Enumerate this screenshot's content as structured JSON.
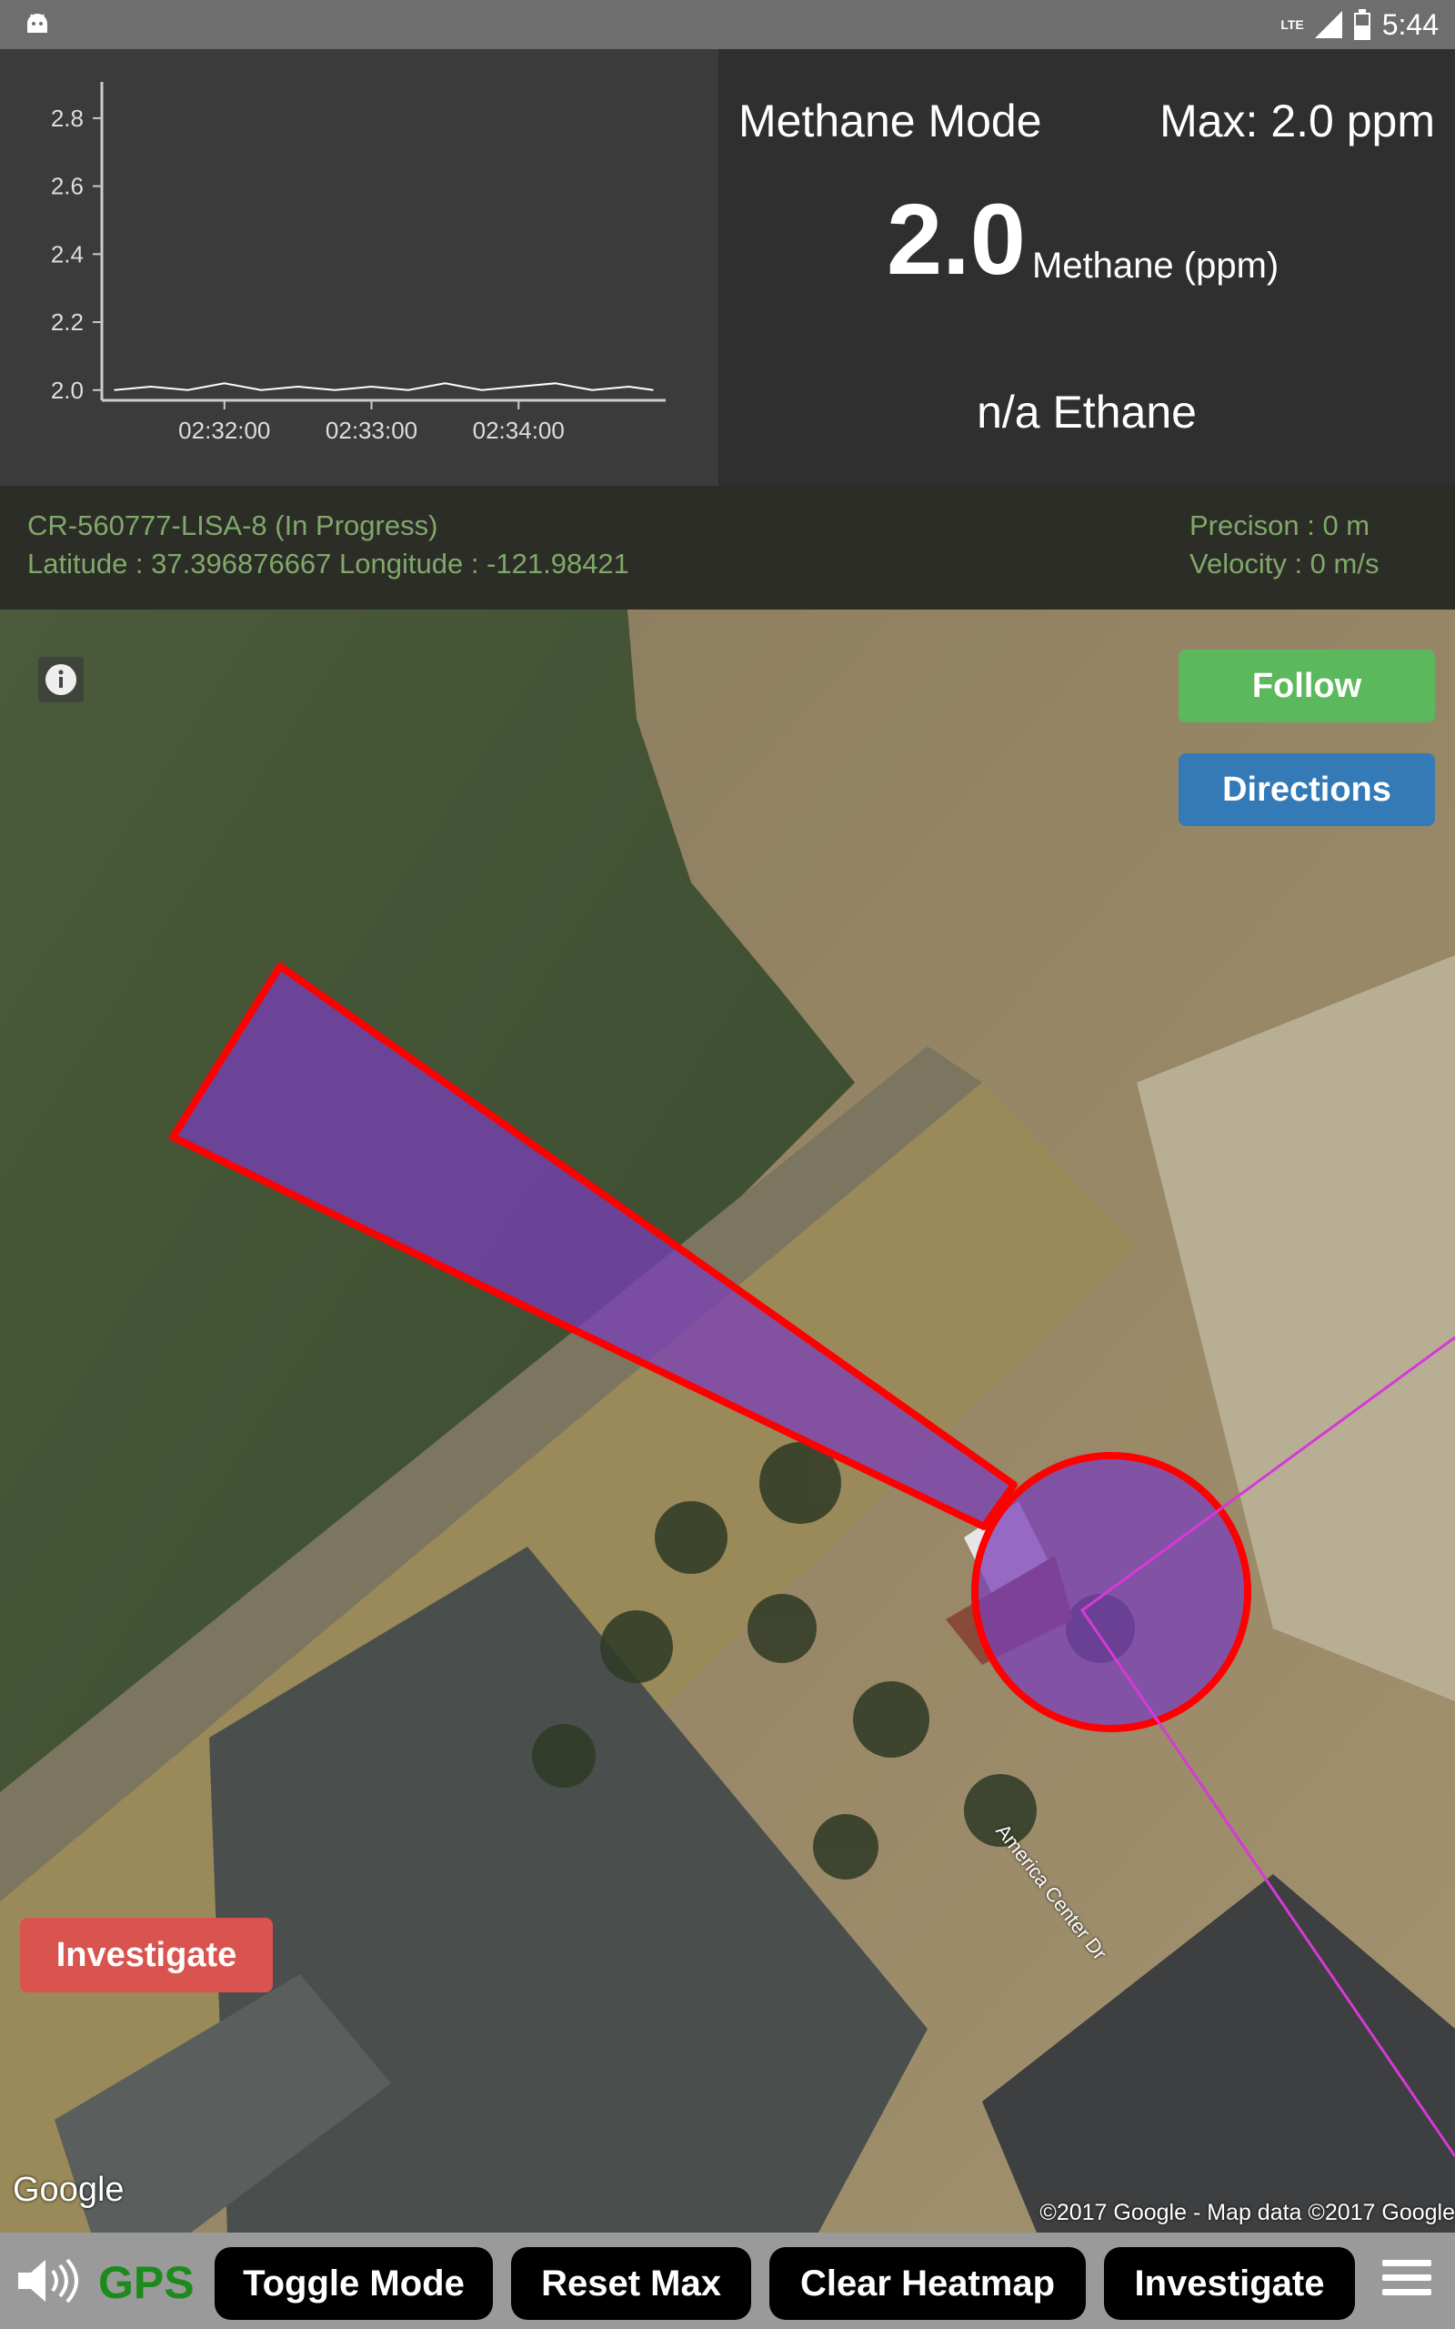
{
  "status_bar": {
    "network": "LTE",
    "time": "5:44",
    "icons": [
      "android-icon",
      "signal-icon",
      "battery-icon"
    ]
  },
  "readings": {
    "mode_title": "Methane Mode",
    "max_label": "Max: 2.0 ppm",
    "methane_value": "2.0",
    "methane_unit": "Methane (ppm)",
    "ethane_label": "n/a Ethane"
  },
  "chart_data": {
    "type": "line",
    "title": "",
    "xlabel": "",
    "ylabel": "",
    "y_ticks": [
      "2.0",
      "2.2",
      "2.4",
      "2.6",
      "2.8"
    ],
    "x_ticks": [
      "02:32:00",
      "02:33:00",
      "02:34:00"
    ],
    "ylim": [
      1.97,
      2.88
    ],
    "x": [
      "02:31:15",
      "02:31:30",
      "02:31:45",
      "02:32:00",
      "02:32:15",
      "02:32:30",
      "02:32:45",
      "02:33:00",
      "02:33:15",
      "02:33:30",
      "02:33:45",
      "02:34:00",
      "02:34:15",
      "02:34:30",
      "02:34:45",
      "02:34:55"
    ],
    "values": [
      2.0,
      2.01,
      2.0,
      2.02,
      2.0,
      2.01,
      2.0,
      2.01,
      2.0,
      2.02,
      2.0,
      2.01,
      2.02,
      2.0,
      2.01,
      2.0
    ],
    "grid": false,
    "colors": {
      "line": "#ffffff",
      "axis": "#cccccc"
    }
  },
  "info": {
    "survey_label": "CR-560777-LISA-8  (In Progress)",
    "location_label": "Latitude : 37.396876667  Longitude  :  -121.98421",
    "precision_label": "Precison : 0  m",
    "velocity_label": "Velocity : 0  m/s"
  },
  "map": {
    "follow_label": "Follow",
    "directions_label": "Directions",
    "investigate_label": "Investigate",
    "google_logo": "Google",
    "copyright": "©2017 Google - Map data ©2017 Google",
    "street_label": "America Center Dr",
    "colors": {
      "cone": "#7a3fb8",
      "outline": "#ff0000",
      "path": "#d63ad6"
    }
  },
  "toolbar": {
    "gps_label": "GPS",
    "toggle_mode_label": "Toggle Mode",
    "reset_max_label": "Reset Max",
    "clear_heatmap_label": "Clear Heatmap",
    "investigate_label": "Investigate",
    "icons": [
      "speaker-icon",
      "menu-icon"
    ]
  }
}
